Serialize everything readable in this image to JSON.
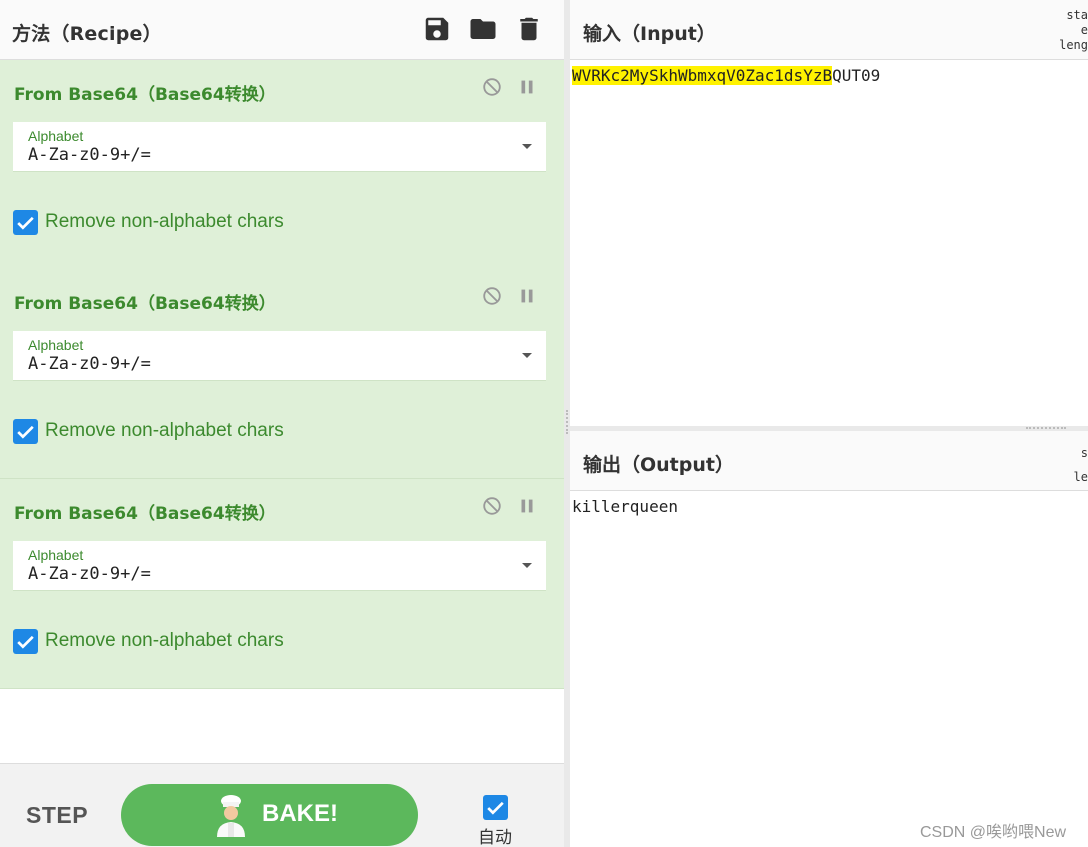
{
  "recipe": {
    "title": "方法（Recipe）",
    "header_icons": [
      "save-icon",
      "folder-icon",
      "trash-icon"
    ],
    "operations": [
      {
        "title": "From Base64（Base64转换）",
        "arg_label": "Alphabet",
        "arg_value": "A-Za-z0-9+/=",
        "checkbox_label": "Remove non-alphabet chars",
        "checked": true
      },
      {
        "title": "From Base64（Base64转换）",
        "arg_label": "Alphabet",
        "arg_value": "A-Za-z0-9+/=",
        "checkbox_label": "Remove non-alphabet chars",
        "checked": true
      },
      {
        "title": "From Base64（Base64转换）",
        "arg_label": "Alphabet",
        "arg_value": "A-Za-z0-9+/=",
        "checkbox_label": "Remove non-alphabet chars",
        "checked": true
      }
    ]
  },
  "controls": {
    "step_label": "STEP",
    "bake_label": "BAKE!",
    "auto_label": "自动",
    "auto_checked": true
  },
  "input": {
    "title": "输入（Input）",
    "stats": [
      "sta",
      "e",
      "leng"
    ],
    "text_highlighted": "WVRKc2MySkhWbmxqV0Zac1dsYzB",
    "text_rest": "QUT09"
  },
  "output": {
    "title": "输出（Output）",
    "stats": [
      "s",
      "le"
    ],
    "text": "killerqueen"
  },
  "watermark": "CSDN @唉哟喂New",
  "colors": {
    "operation_bg": "#dff0d8",
    "operation_text": "#3c8a2e",
    "checkbox": "#1e88e5",
    "bake_button": "#5cb85c",
    "highlight": "#fff200"
  }
}
